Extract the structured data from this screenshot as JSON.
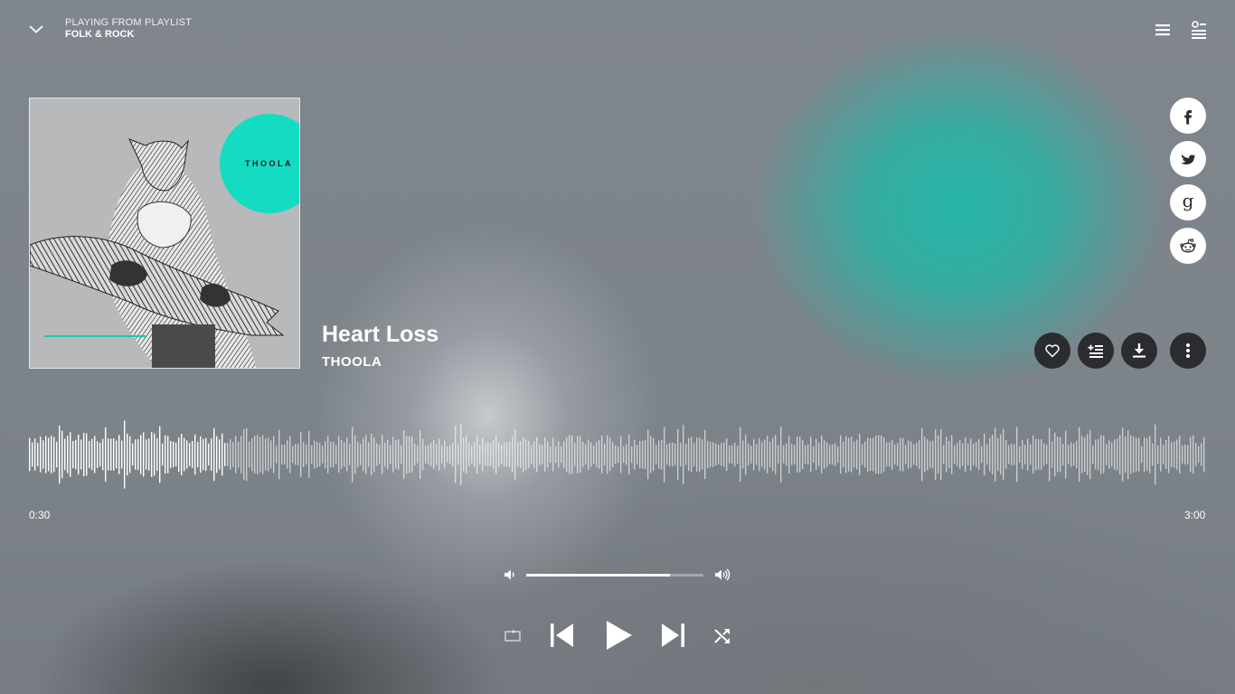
{
  "header": {
    "caption": "PLAYING FROM PLAYLIST",
    "playlist_name": "FOLK & ROCK",
    "collapse_icon": "chevron-down-icon",
    "menu_icon": "menu-icon",
    "queue_icon": "queue-list-icon"
  },
  "album": {
    "art_text": "THOOLA",
    "accent_color": "#14dcc3"
  },
  "track": {
    "title": "Heart Loss",
    "artist": "THOOLA"
  },
  "share": [
    {
      "name": "facebook",
      "icon": "facebook-icon"
    },
    {
      "name": "twitter",
      "icon": "twitter-icon"
    },
    {
      "name": "google",
      "icon": "google-icon"
    },
    {
      "name": "reddit",
      "icon": "reddit-icon"
    }
  ],
  "actions": [
    {
      "name": "like",
      "icon": "heart-icon"
    },
    {
      "name": "add-to-playlist",
      "icon": "playlist-add-icon"
    },
    {
      "name": "download",
      "icon": "download-icon"
    },
    {
      "name": "more",
      "icon": "more-vertical-icon"
    }
  ],
  "progress": {
    "current_time": "0:30",
    "total_time": "3:00",
    "played_fraction": 0.1667
  },
  "volume": {
    "level": 0.81,
    "mute_icon": "volume-low-icon",
    "max_icon": "volume-high-icon"
  },
  "transport": {
    "repeat_icon": "repeat-icon",
    "previous_icon": "skip-previous-icon",
    "play_icon": "play-icon",
    "next_icon": "skip-next-icon",
    "shuffle_icon": "shuffle-icon"
  },
  "theme": {
    "accent": "#20b8a8",
    "button_dark": "#2a2c2f"
  }
}
